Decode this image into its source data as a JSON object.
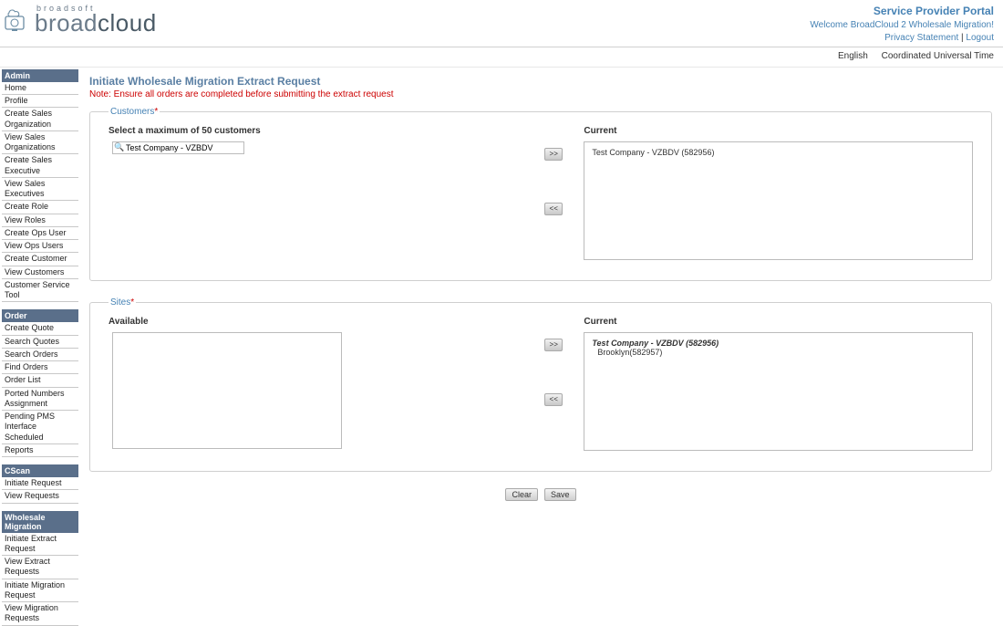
{
  "brand": {
    "line1": "broadsoft",
    "name_pre": "broad",
    "name_bold": "cloud"
  },
  "header": {
    "portal_title": "Service Provider Portal",
    "welcome": "Welcome BroadCloud 2 Wholesale Migration!",
    "privacy": "Privacy Statement",
    "logout": "Logout"
  },
  "subbar": {
    "lang": "English",
    "tz": "Coordinated Universal Time"
  },
  "sidebar": {
    "groups": [
      {
        "title": "Admin",
        "items": [
          "Home",
          "Profile",
          "Create Sales Organization",
          "View Sales Organizations",
          "Create Sales Executive",
          "View Sales Executives",
          "Create Role",
          "View Roles",
          "Create Ops User",
          "View Ops Users",
          "Create Customer",
          "View Customers",
          "Customer Service Tool"
        ]
      },
      {
        "title": "Order",
        "items": [
          "Create Quote",
          "Search Quotes",
          "Search Orders",
          "Find Orders",
          "Order List",
          "Ported Numbers Assignment",
          "Pending PMS Interface Scheduled",
          "Reports"
        ]
      },
      {
        "title": "CScan",
        "items": [
          "Initiate Request",
          "View Requests"
        ]
      },
      {
        "title": "Wholesale Migration",
        "items": [
          "Initiate Extract Request",
          "View Extract Requests",
          "Initiate Migration Request",
          "View Migration Requests"
        ]
      }
    ]
  },
  "main": {
    "title": "Initiate Wholesale Migration Extract Request",
    "note": "Note: Ensure all orders are completed before submitting the extract request",
    "customers": {
      "legend": "Customers",
      "select_label": "Select a maximum of 50 customers",
      "current_label": "Current",
      "search_value": "Test Company - VZBDV",
      "current_list": [
        "Test Company - VZBDV (582956)"
      ]
    },
    "sites": {
      "legend": "Sites",
      "available_label": "Available",
      "current_label": "Current",
      "current_entries": [
        {
          "head": "Test Company - VZBDV (582956)",
          "sub": "Brooklyn(582957)"
        }
      ]
    },
    "buttons": {
      "move_right": ">>",
      "move_left": "<<",
      "clear": "Clear",
      "save": "Save"
    }
  }
}
